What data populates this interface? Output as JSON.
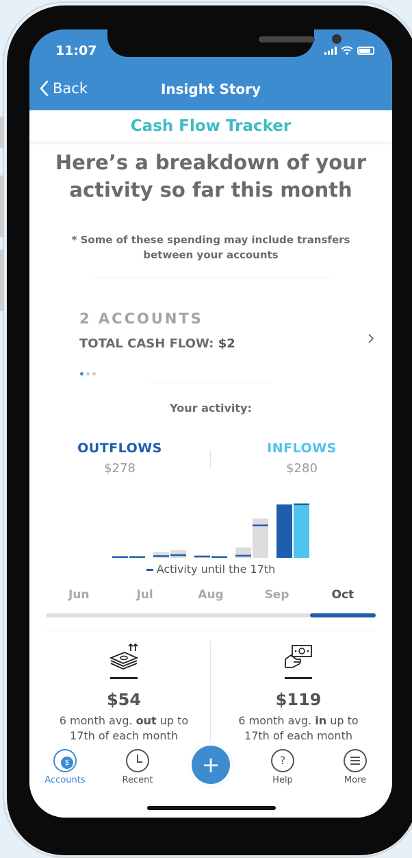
{
  "status": {
    "time": "11:07"
  },
  "nav": {
    "back_label": "Back",
    "title": "Insight Story"
  },
  "subheader": {
    "title": "Cash Flow Tracker"
  },
  "content": {
    "heading_line1": "Here’s a breakdown of your",
    "heading_line2": "activity so far this month",
    "note_line1": "* Some of these spending may include transfers",
    "note_line2": "between your accounts"
  },
  "accounts": {
    "count_label": "2 ACCOUNTS",
    "total_label": "TOTAL CASH FLOW:",
    "total_value": "$2",
    "page_index": 0,
    "page_count": 3
  },
  "activity": {
    "label": "Your activity:",
    "outflows_title": "OUTFLOWS",
    "outflows_amount": "$278",
    "inflows_title": "INFLOWS",
    "inflows_amount": "$280",
    "legend": "Activity until the 17th"
  },
  "months": [
    "Jun",
    "Jul",
    "Aug",
    "Sep",
    "Oct"
  ],
  "selected_month": "Oct",
  "stats": {
    "out_value": "$54",
    "out_desc_pre": "6 month avg. ",
    "out_desc_bold": "out",
    "out_desc_post": " up to",
    "out_desc_line2": "17th of each month",
    "in_value": "$119",
    "in_desc_pre": "6 month avg. ",
    "in_desc_bold": "in",
    "in_desc_post": " up to",
    "in_desc_line2": "17th of each month"
  },
  "tabs": [
    {
      "label": "Accounts",
      "icon": "accounts-icon"
    },
    {
      "label": "Recent",
      "icon": "clock-icon"
    },
    {
      "label": "Help",
      "icon": "help-icon"
    },
    {
      "label": "More",
      "icon": "menu-icon"
    }
  ],
  "colors": {
    "brand": "#3e8cd0",
    "outflow": "#1d5fad",
    "inflow": "#4fc4ec",
    "accent_teal": "#3fbcc4"
  },
  "chart_data": {
    "type": "bar",
    "categories": [
      "Jun",
      "Jul",
      "Aug",
      "Sep",
      "Oct"
    ],
    "series": [
      {
        "name": "OUTFLOWS",
        "values": [
          5,
          30,
          12,
          55,
          278
        ]
      },
      {
        "name": "INFLOWS",
        "values": [
          5,
          40,
          8,
          205,
          280
        ]
      }
    ],
    "partial_series": [
      {
        "name": "Activity until the 17th",
        "outflow_values": [
          5,
          10,
          8,
          12,
          278
        ],
        "inflow_values": [
          5,
          15,
          5,
          170,
          280
        ]
      }
    ],
    "ylim": [
      0,
      300
    ],
    "legend": "bottom"
  }
}
